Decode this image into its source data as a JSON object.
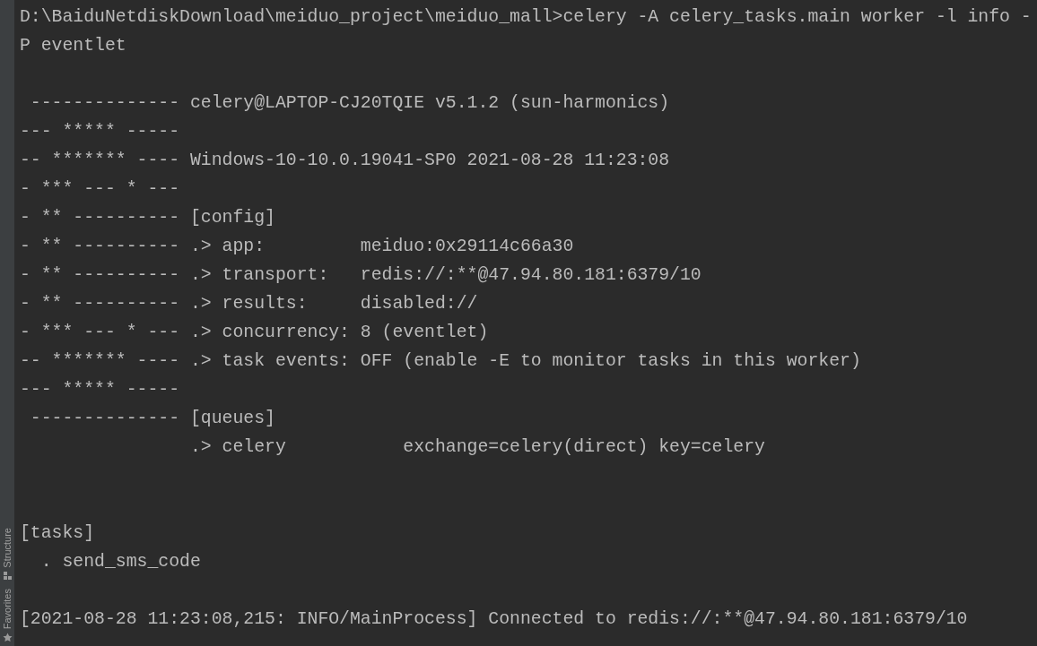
{
  "sidebar": {
    "items": [
      {
        "label": "Structure",
        "kind": "structure"
      },
      {
        "label": "Favorites",
        "kind": "favorites"
      }
    ]
  },
  "terminal": {
    "lines": [
      {
        "kind": "text",
        "text": "D:\\BaiduNetdiskDownload\\meiduo_project\\meiduo_mall>celery -A celery_tasks.main worker -l info -"
      },
      {
        "kind": "text",
        "text": "P eventlet"
      },
      {
        "kind": "blank"
      },
      {
        "kind": "text",
        "text": " -------------- celery@LAPTOP-CJ20TQIE v5.1.2 (sun-harmonics)"
      },
      {
        "kind": "text",
        "text": "--- ***** -----"
      },
      {
        "kind": "text",
        "text": "-- ******* ---- Windows-10-10.0.19041-SP0 2021-08-28 11:23:08"
      },
      {
        "kind": "text",
        "text": "- *** --- * ---"
      },
      {
        "kind": "text",
        "text": "- ** ---------- [config]"
      },
      {
        "kind": "text",
        "text": "- ** ---------- .> app:         meiduo:0x29114c66a30"
      },
      {
        "kind": "text",
        "text": "- ** ---------- .> transport:   redis://:**@47.94.80.181:6379/10"
      },
      {
        "kind": "text",
        "text": "- ** ---------- .> results:     disabled://"
      },
      {
        "kind": "text",
        "text": "- *** --- * --- .> concurrency: 8 (eventlet)"
      },
      {
        "kind": "text",
        "text": "-- ******* ---- .> task events: OFF (enable -E to monitor tasks in this worker)"
      },
      {
        "kind": "text",
        "text": "--- ***** -----"
      },
      {
        "kind": "text",
        "text": " -------------- [queues]"
      },
      {
        "kind": "text",
        "text": "                .> celery           exchange=celery(direct) key=celery"
      },
      {
        "kind": "blank"
      },
      {
        "kind": "blank"
      },
      {
        "kind": "text",
        "text": "[tasks]"
      },
      {
        "kind": "text",
        "text": "  . send_sms_code"
      },
      {
        "kind": "blank"
      },
      {
        "kind": "text",
        "text": "[2021-08-28 11:23:08,215: INFO/MainProcess] Connected to redis://:**@47.94.80.181:6379/10"
      }
    ]
  }
}
